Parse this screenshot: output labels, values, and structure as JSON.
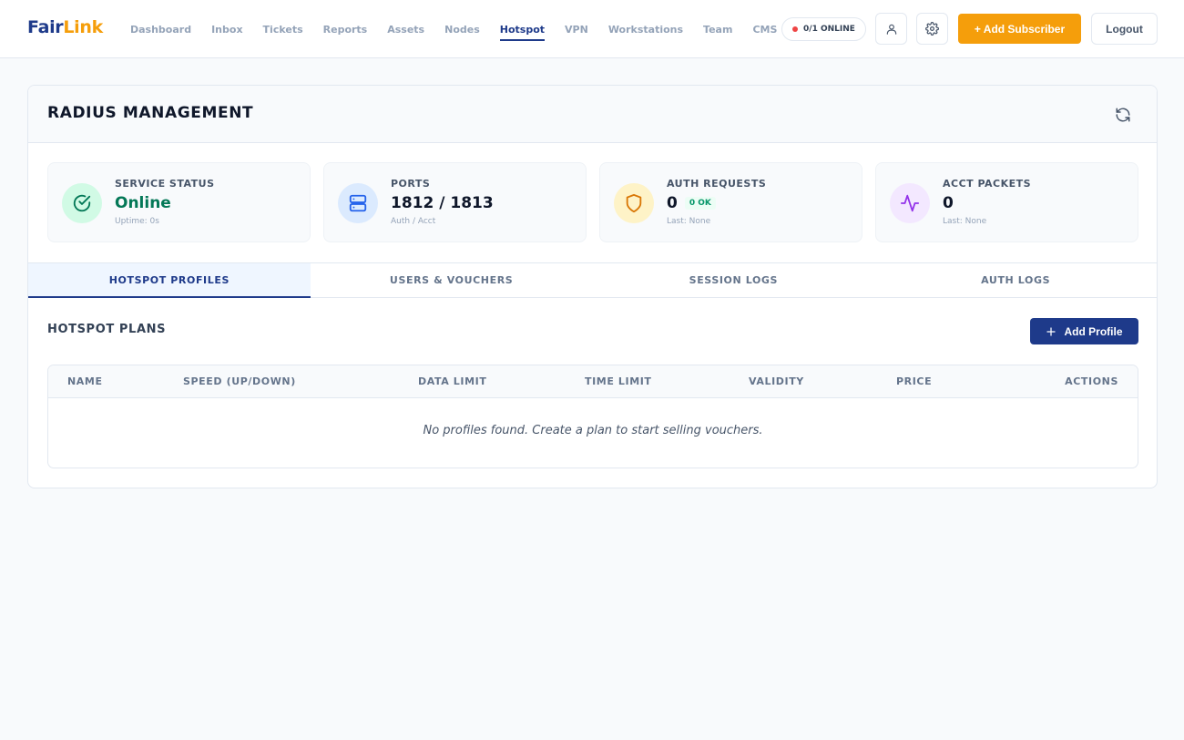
{
  "app": {
    "logo_part1": "Fair",
    "logo_part2": "Link"
  },
  "nav": {
    "items": [
      {
        "label": "Dashboard"
      },
      {
        "label": "Inbox"
      },
      {
        "label": "Tickets"
      },
      {
        "label": "Reports"
      },
      {
        "label": "Assets"
      },
      {
        "label": "Nodes"
      },
      {
        "label": "Hotspot",
        "active": true
      },
      {
        "label": "VPN"
      },
      {
        "label": "Workstations"
      },
      {
        "label": "Team"
      },
      {
        "label": "CMS"
      }
    ],
    "online_status": "0/1 ONLINE",
    "online_dot_color": "#ef4444",
    "user_icon": "user-icon",
    "settings_icon": "gear-icon",
    "add_subscriber_label": "+ Add Subscriber",
    "logout_label": "Logout"
  },
  "radius": {
    "title": "RADIUS MANAGEMENT",
    "refresh_icon": "refresh-icon",
    "stats": [
      {
        "label": "SERVICE STATUS",
        "value": "Online",
        "sub": "Uptime: 0s",
        "icon": "check-circle-icon",
        "color": "#047857"
      },
      {
        "label": "PORTS",
        "value": "1812 / 1813",
        "sub": "Auth / Acct",
        "icon": "server-icon",
        "color": "#2563eb"
      },
      {
        "label": "AUTH REQUESTS",
        "value": "0",
        "badge": "0 OK",
        "sub": "Last: None",
        "icon": "shield-icon",
        "color": "#d97706"
      },
      {
        "label": "ACCT PACKETS",
        "value": "0",
        "sub": "Last: None",
        "icon": "activity-icon",
        "color": "#9333ea"
      }
    ],
    "tabs": [
      {
        "label": "HOTSPOT PROFILES",
        "active": true
      },
      {
        "label": "USERS & VOUCHERS"
      },
      {
        "label": "SESSION LOGS"
      },
      {
        "label": "AUTH LOGS"
      }
    ],
    "section_title": "HOTSPOT PLANS",
    "add_profile_label": "Add Profile",
    "table": {
      "columns": [
        "NAME",
        "SPEED (UP/DOWN)",
        "DATA LIMIT",
        "TIME LIMIT",
        "VALIDITY",
        "PRICE",
        "ACTIONS"
      ],
      "empty_message": "No profiles found. Create a plan to start selling vouchers."
    }
  },
  "colors": {
    "brand_primary": "#1e3a8a",
    "brand_accent": "#f59e0b"
  }
}
